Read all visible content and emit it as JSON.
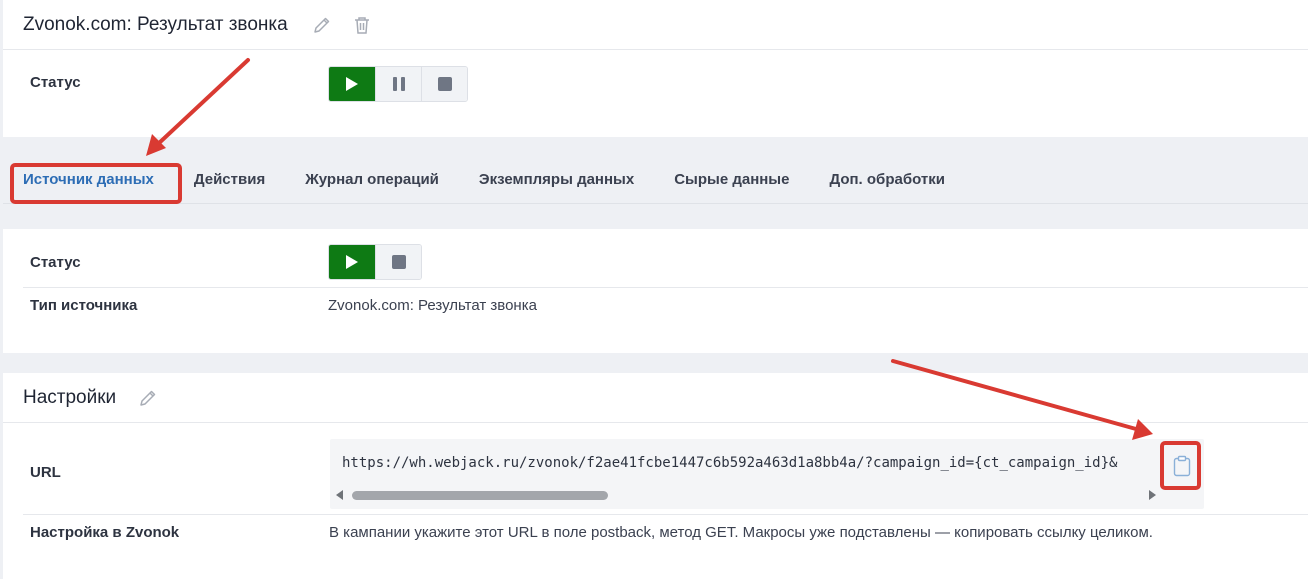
{
  "header": {
    "title": "Zvonok.com: Результат звонка",
    "edit_icon": "pencil-icon",
    "delete_icon": "trash-icon"
  },
  "status_card": {
    "label": "Статус",
    "state": "running"
  },
  "tabs": [
    {
      "label": "Источник данных",
      "active": true
    },
    {
      "label": "Действия",
      "active": false
    },
    {
      "label": "Журнал операций",
      "active": false
    },
    {
      "label": "Экземпляры данных",
      "active": false
    },
    {
      "label": "Сырые данные",
      "active": false
    },
    {
      "label": "Доп. обработки",
      "active": false
    }
  ],
  "source": {
    "status_label": "Статус",
    "type_label": "Тип источника",
    "type_value": "Zvonok.com: Результат звонка"
  },
  "settings": {
    "title": "Настройки",
    "url_label": "URL",
    "url_value": "https://wh.webjack.ru/zvonok/f2ae41fcbe1447c6b592a463d1a8bb4a/?campaign_id={ct_campaign_id}&",
    "zvonok_label": "Настройка в Zvonok",
    "zvonok_value": "В кампании укажите этот URL в поле postback, метод GET. Макросы уже подставлены — копировать ссылку целиком."
  },
  "colors": {
    "accent": "#2d6db5",
    "play_active": "#0e7a14",
    "annotation": "#d93a32"
  }
}
